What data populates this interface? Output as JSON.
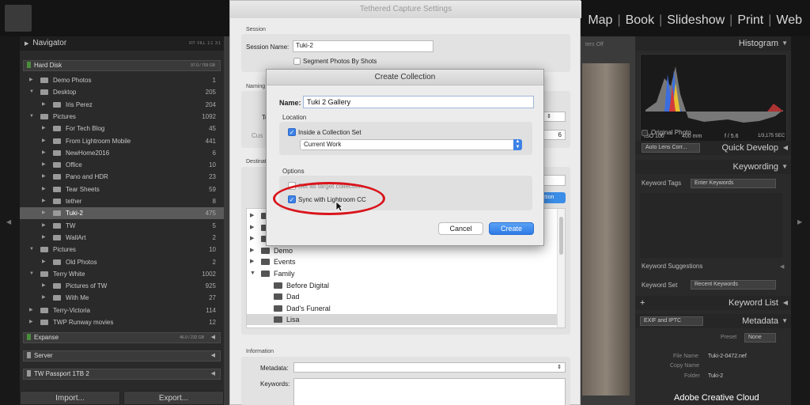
{
  "topbar": {
    "modules": [
      "Map",
      "Book",
      "Slideshow",
      "Print",
      "Web"
    ]
  },
  "left_panel": {
    "navigator": {
      "title": "Navigator",
      "zoom_options": [
        "FIT",
        "FILL",
        "1:1",
        "3:1"
      ]
    },
    "hard_disk": {
      "label": "Hard Disk",
      "size": "97.0 / 769 GB"
    },
    "folders": [
      {
        "name": "Demo Photos",
        "count": "1",
        "level": 1,
        "expanded": false,
        "selected": false
      },
      {
        "name": "Desktop",
        "count": "205",
        "level": 1,
        "expanded": true,
        "selected": false
      },
      {
        "name": "Iris Perez",
        "count": "204",
        "level": 2,
        "expanded": false,
        "selected": false
      },
      {
        "name": "Pictures",
        "count": "1092",
        "level": 1,
        "expanded": true,
        "selected": false
      },
      {
        "name": "For Tech Blog",
        "count": "45",
        "level": 2,
        "expanded": false,
        "selected": false
      },
      {
        "name": "From Lightroom Mobile",
        "count": "441",
        "level": 2,
        "expanded": false,
        "selected": false
      },
      {
        "name": "NewHome2016",
        "count": "6",
        "level": 2,
        "expanded": false,
        "selected": false
      },
      {
        "name": "Office",
        "count": "10",
        "level": 2,
        "expanded": false,
        "selected": false
      },
      {
        "name": "Pano and HDR",
        "count": "23",
        "level": 2,
        "expanded": false,
        "selected": false
      },
      {
        "name": "Tear Sheets",
        "count": "59",
        "level": 2,
        "expanded": false,
        "selected": false
      },
      {
        "name": "tether",
        "count": "8",
        "level": 2,
        "expanded": false,
        "selected": false
      },
      {
        "name": "Tuki-2",
        "count": "475",
        "level": 2,
        "expanded": false,
        "selected": true
      },
      {
        "name": "TW",
        "count": "5",
        "level": 2,
        "expanded": false,
        "selected": false
      },
      {
        "name": "WallArt",
        "count": "2",
        "level": 2,
        "expanded": false,
        "selected": false
      },
      {
        "name": "Pictures",
        "count": "10",
        "level": 1,
        "expanded": true,
        "selected": false
      },
      {
        "name": "Old Photos",
        "count": "2",
        "level": 2,
        "expanded": false,
        "selected": false
      },
      {
        "name": "Terry White",
        "count": "1002",
        "level": 1,
        "expanded": true,
        "selected": false
      },
      {
        "name": "Pictures of TW",
        "count": "925",
        "level": 2,
        "expanded": false,
        "selected": false
      },
      {
        "name": "With Me",
        "count": "27",
        "level": 2,
        "expanded": false,
        "selected": false
      },
      {
        "name": "Terry-Victoria",
        "count": "114",
        "level": 1,
        "expanded": false,
        "selected": false
      },
      {
        "name": "TWP Runway movies",
        "count": "12",
        "level": 1,
        "expanded": false,
        "selected": false
      }
    ],
    "volumes": [
      {
        "label": "Expanse",
        "size": "46.0 / 232 GB"
      },
      {
        "label": "Server",
        "size": ""
      },
      {
        "label": "TW Passport 1TB 2",
        "size": ""
      }
    ],
    "import_label": "Import...",
    "export_label": "Export..."
  },
  "center": {
    "filters_label": "ters Off"
  },
  "right_panel": {
    "histogram_title": "Histogram",
    "iso": "ISO 100",
    "focal": "400 mm",
    "aperture": "f / 5.6",
    "shutter": "1/3,175 SEC",
    "original_photo": "Original Photo",
    "quick_develop": "Quick Develop",
    "preset_value": "Auto Lens Corr...",
    "keywording": "Keywording",
    "keyword_tags_label": "Keyword Tags",
    "keyword_tags_value": "Enter Keywords",
    "keyword_suggestions": "Keyword Suggestions",
    "keyword_set_label": "Keyword Set",
    "keyword_set_value": "Recent Keywords",
    "keyword_list": "Keyword List",
    "metadata": "Metadata",
    "metadata_preset_select": "EXIF and IPTC",
    "preset_label": "Preset",
    "preset_none": "None",
    "file_name_label": "File Name",
    "file_name_value": "Tuki-2-0472.nef",
    "copy_name_label": "Copy Name",
    "folder_label": "Folder",
    "folder_value": "Tuki-2",
    "cc_badge": "Adobe Creative Cloud"
  },
  "tether_dialog": {
    "title": "Tethered Capture Settings",
    "session_section": "Session",
    "session_name_label": "Session Name:",
    "session_name_value": "Tuki-2",
    "segment_label": "Segment Photos By Shots",
    "naming_section": "Naming",
    "destination_section": "Destinat",
    "tree_items": [
      {
        "label": "",
        "expanded": false
      },
      {
        "label": "",
        "expanded": false
      },
      {
        "label": "",
        "expanded": false
      },
      {
        "label": "Demo",
        "expanded": false
      },
      {
        "label": "Events",
        "expanded": false
      },
      {
        "label": "Family",
        "expanded": true
      },
      {
        "label": "Before Digital",
        "expanded": false
      },
      {
        "label": "Dad",
        "expanded": false
      },
      {
        "label": "Dad's Funeral",
        "expanded": false
      },
      {
        "label": "Lisa",
        "expanded": false,
        "selected": true
      }
    ],
    "information_section": "Information",
    "metadata_label": "Metadata:",
    "keywords_label": "Keywords:",
    "naming_partial": "Te",
    "custom_partial": "Cus",
    "shots_partial": "6"
  },
  "create_collection": {
    "title": "Create Collection",
    "name_label": "Name:",
    "name_value": "Tuki 2 Gallery",
    "location_section": "Location",
    "inside_set_label": "Inside a Collection Set",
    "inside_set_checked": true,
    "collection_set_value": "Current Work",
    "options_section": "Options",
    "set_target_label": "Set as target collection",
    "set_target_checked": false,
    "sync_label": "Sync with Lightroom CC",
    "sync_checked": true,
    "cancel_label": "Cancel",
    "create_label": "Create"
  },
  "colors": {
    "accent_blue": "#3d82e6",
    "highlight_red": "#d9141b",
    "selection_gray": "#5a5a5a"
  }
}
